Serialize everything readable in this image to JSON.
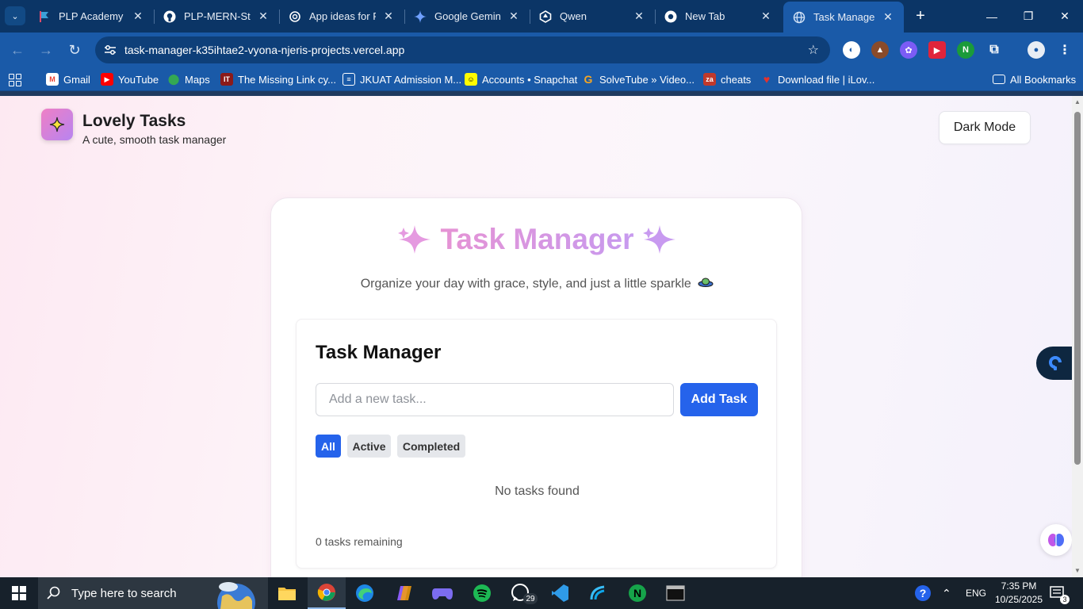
{
  "browser": {
    "tabs": [
      {
        "title": "PLP Academy",
        "icon": "plp-favicon"
      },
      {
        "title": "PLP-MERN-Stack",
        "icon": "github-icon"
      },
      {
        "title": "App ideas for Re",
        "icon": "chatgpt-icon"
      },
      {
        "title": "Google Gemini",
        "icon": "gemini-icon"
      },
      {
        "title": "Qwen",
        "icon": "qwen-icon"
      },
      {
        "title": "New Tab",
        "icon": "chrome-icon"
      },
      {
        "title": "Task Manager A",
        "icon": "globe-icon",
        "active": true
      }
    ],
    "url": "task-manager-k35ihtae2-vyona-njeris-projects.vercel.app",
    "bookmarks": [
      {
        "label": "Gmail",
        "icon": "gmail-icon",
        "color": "#ea4335"
      },
      {
        "label": "YouTube",
        "icon": "youtube-icon",
        "color": "#ff0000"
      },
      {
        "label": "Maps",
        "icon": "maps-icon",
        "color": "#34a853"
      },
      {
        "label": "The Missing Link cy...",
        "icon": "it-icon",
        "color": "#8b1a1a"
      },
      {
        "label": "JKUAT Admission M...",
        "icon": "doc-icon",
        "color": "#555555"
      },
      {
        "label": "Accounts • Snapchat",
        "icon": "snapchat-icon",
        "color": "#fffc00"
      },
      {
        "label": "SolveTube » Video...",
        "icon": "g-icon",
        "color": "#f5a623"
      },
      {
        "label": "cheats",
        "icon": "za-icon",
        "color": "#c0392b"
      },
      {
        "label": "Download file | iLov...",
        "icon": "heart-icon",
        "color": "#e5322d"
      }
    ],
    "all_bookmarks": "All Bookmarks"
  },
  "app": {
    "brand_title": "Lovely Tasks",
    "brand_subtitle": "A cute, smooth task manager",
    "dark_mode_label": "Dark Mode",
    "hero_title": "Task Manager",
    "hero_subtitle": "Organize your day with grace, style, and just a little sparkle",
    "panel_title": "Task Manager",
    "input_placeholder": "Add a new task...",
    "add_button": "Add Task",
    "filters": [
      {
        "label": "All",
        "active": true
      },
      {
        "label": "Active",
        "active": false
      },
      {
        "label": "Completed",
        "active": false
      }
    ],
    "empty_message": "No tasks found",
    "remaining": "0 tasks remaining",
    "accent_color": "#2563eb"
  },
  "taskbar": {
    "search_placeholder": "Type here to search",
    "whatsapp_badge": "29",
    "language": "ENG",
    "time": "7:35 PM",
    "date": "10/25/2025",
    "notifications": "3"
  }
}
